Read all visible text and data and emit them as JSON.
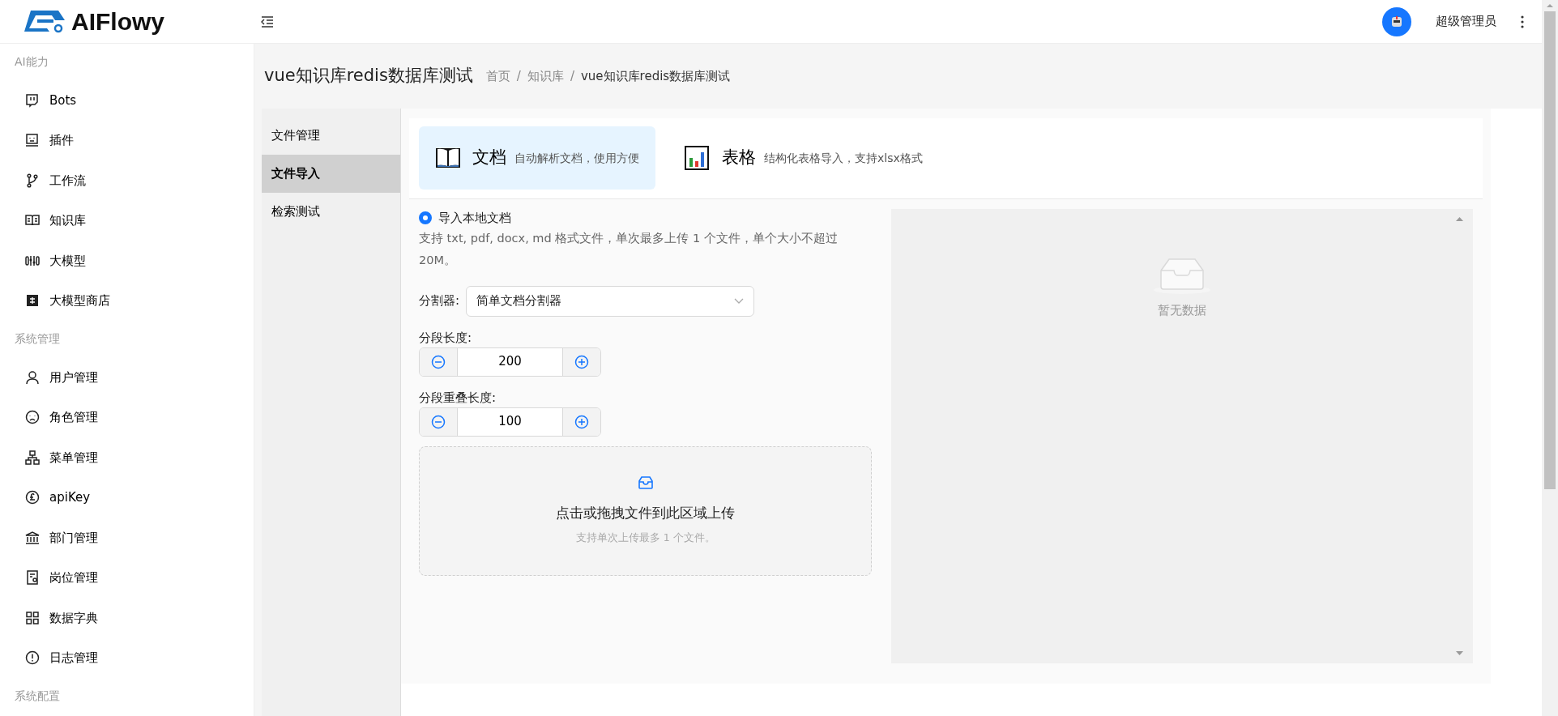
{
  "header": {
    "logo_text": "AIFlowy",
    "user_name": "超级管理员"
  },
  "sidebar": {
    "groups": [
      {
        "title": "AI能力",
        "items": [
          {
            "label": "Bots"
          },
          {
            "label": "插件"
          },
          {
            "label": "工作流"
          },
          {
            "label": "知识库"
          },
          {
            "label": "大模型"
          },
          {
            "label": "大模型商店"
          }
        ]
      },
      {
        "title": "系统管理",
        "items": [
          {
            "label": "用户管理"
          },
          {
            "label": "角色管理"
          },
          {
            "label": "菜单管理"
          },
          {
            "label": "apiKey"
          },
          {
            "label": "部门管理"
          },
          {
            "label": "岗位管理"
          },
          {
            "label": "数据字典"
          },
          {
            "label": "日志管理"
          }
        ]
      },
      {
        "title": "系统配置"
      }
    ]
  },
  "page": {
    "title": "vue知识库redis数据库测试",
    "breadcrumb": [
      {
        "kind": "link",
        "label": "首页"
      },
      {
        "kind": "separator",
        "label": "/"
      },
      {
        "kind": "link",
        "label": "知识库"
      },
      {
        "kind": "separator",
        "label": "/"
      },
      {
        "kind": "current",
        "label": "vue知识库redis数据库测试"
      }
    ]
  },
  "sub_menu": [
    {
      "label": "文件管理",
      "selected": false
    },
    {
      "label": "文件导入",
      "selected": true
    },
    {
      "label": "检索测试",
      "selected": false
    }
  ],
  "import_types": [
    {
      "kind": "book",
      "title": "文档",
      "description": "自动解析文档，使用方便",
      "selected": true
    },
    {
      "kind": "chart",
      "title": "表格",
      "description": "结构化表格导入，支持xlsx格式",
      "selected": false
    }
  ],
  "form": {
    "source": {
      "label": "导入本地文档",
      "selected": true
    },
    "hint": "支持 txt, pdf, docx, md 格式文件，单次最多上传 1 个文件，单个大小不超过 20M。",
    "splitter": {
      "label": "分割器:",
      "value": "简单文档分割器"
    },
    "steppers": [
      {
        "label": "分段长度:",
        "value": "200"
      },
      {
        "label": "分段重叠长度:",
        "value": "100"
      }
    ],
    "upload": {
      "title": "点击或拖拽文件到此区域上传",
      "hint": "支持单次上传最多 1 个文件。"
    }
  },
  "preview": {
    "empty_text": "暂无数据"
  }
}
